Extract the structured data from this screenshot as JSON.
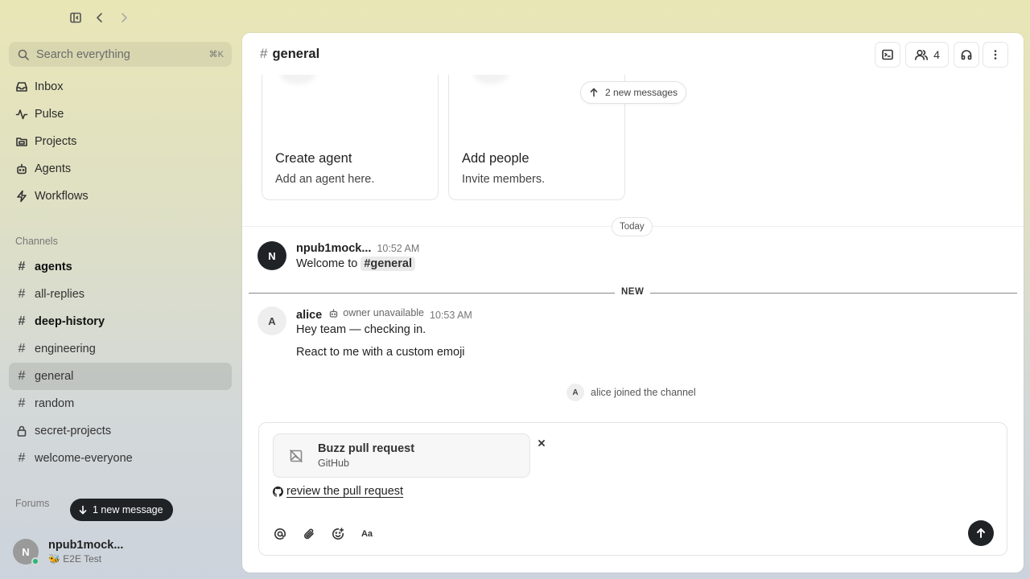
{
  "sidebar": {
    "search_placeholder": "Search everything",
    "search_shortcut": "⌘K",
    "nav": [
      {
        "label": "Inbox",
        "icon": "inbox-icon"
      },
      {
        "label": "Pulse",
        "icon": "pulse-icon"
      },
      {
        "label": "Projects",
        "icon": "folder-icon"
      },
      {
        "label": "Agents",
        "icon": "bot-icon"
      },
      {
        "label": "Workflows",
        "icon": "lightning-icon"
      }
    ],
    "channels_label": "Channels",
    "channels": [
      {
        "name": "agents",
        "bold": true
      },
      {
        "name": "all-replies"
      },
      {
        "name": "deep-history",
        "bold": true
      },
      {
        "name": "engineering"
      },
      {
        "name": "general",
        "active": true
      },
      {
        "name": "random"
      },
      {
        "name": "secret-projects",
        "locked": true
      },
      {
        "name": "welcome-everyone"
      }
    ],
    "forums_label": "Forums",
    "new_message_pill": "1 new message",
    "user": {
      "initial": "N",
      "name": "npub1mock...",
      "status": "🐝 E2E Test"
    }
  },
  "header": {
    "title": "general",
    "member_count": "4"
  },
  "cards": [
    {
      "title": "Create agent",
      "subtitle": "Add an agent here."
    },
    {
      "title": "Add people",
      "subtitle": "Invite members."
    }
  ],
  "new_messages_badge": "2 new messages",
  "day_label": "Today",
  "messages": [
    {
      "initial": "N",
      "author": "npub1mock...",
      "time": "10:52 AM",
      "text_prefix": "Welcome to",
      "channel_chip": "#general"
    },
    {
      "initial": "A",
      "author": "alice",
      "owner_note": "owner unavailable",
      "time": "10:53 AM",
      "lines": [
        "Hey team — checking in.",
        "React to me with a custom emoji"
      ]
    }
  ],
  "new_divider_label": "NEW",
  "joined": {
    "initial": "A",
    "text": "alice joined the channel"
  },
  "composer": {
    "attachment_title": "Buzz pull request",
    "attachment_subtitle": "GitHub",
    "link_text": "review the pull request",
    "format_label": "Aa"
  }
}
